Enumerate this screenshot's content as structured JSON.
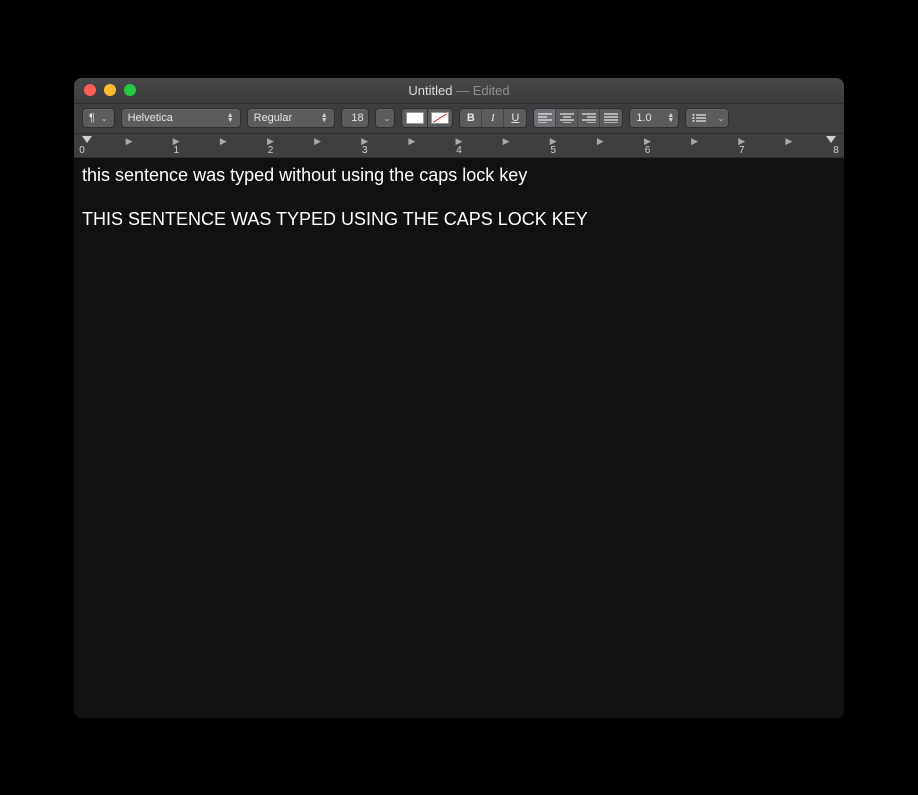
{
  "title": {
    "docname": "Untitled",
    "status": "— Edited"
  },
  "toolbar": {
    "paragraph_symbol": "¶",
    "font": "Helvetica",
    "weight": "Regular",
    "size": "18",
    "bold": "B",
    "italic": "I",
    "underline": "U",
    "spacing": "1.0"
  },
  "ruler": {
    "numbers": [
      "0",
      "1",
      "2",
      "3",
      "4",
      "5",
      "6",
      "7",
      "8"
    ],
    "tab_marks_per_inch": 2
  },
  "document": {
    "line1": "this sentence was typed without using the caps lock key",
    "line2": "THIS SENTENCE WAS TYPED USING THE CAPS LOCK KEY"
  }
}
